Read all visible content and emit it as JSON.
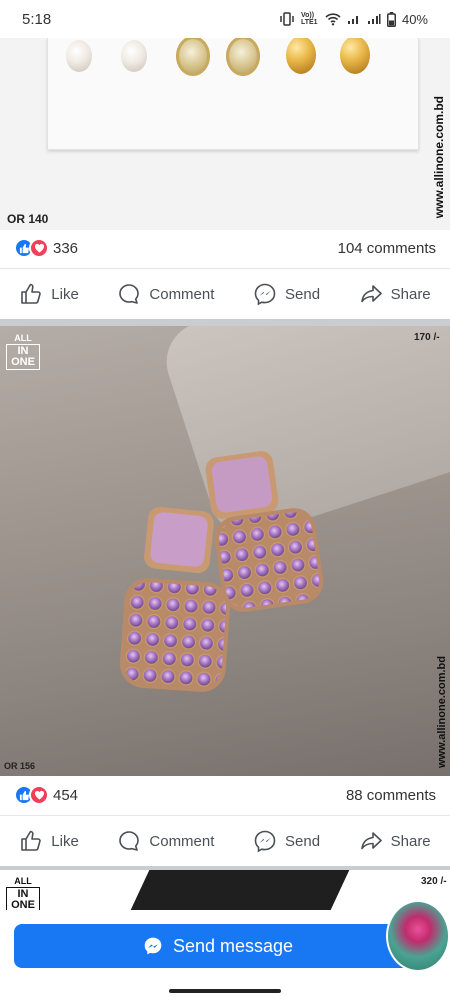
{
  "status": {
    "time": "5:18",
    "battery": "40%",
    "volte": "Vo)) LTE1"
  },
  "posts": [
    {
      "code": "OR 140",
      "watermark": "www.allinone.com.bd",
      "likes": "336",
      "comments": "104 comments"
    },
    {
      "price": "170 /-",
      "code": "OR 156",
      "watermark": "www.allinone.com.bd",
      "likes": "454",
      "comments": "88 comments",
      "logo": {
        "line1": "ALL",
        "line2": "IN ONE"
      }
    },
    {
      "price": "320 /-",
      "logo": {
        "line1": "ALL",
        "line2": "IN ONE"
      }
    }
  ],
  "actions": {
    "like": "Like",
    "comment": "Comment",
    "send": "Send",
    "share": "Share"
  },
  "send_message": "Send message",
  "colors": {
    "accent": "#1877f2",
    "love": "#f33e58",
    "separator": "#c9ccd1"
  }
}
